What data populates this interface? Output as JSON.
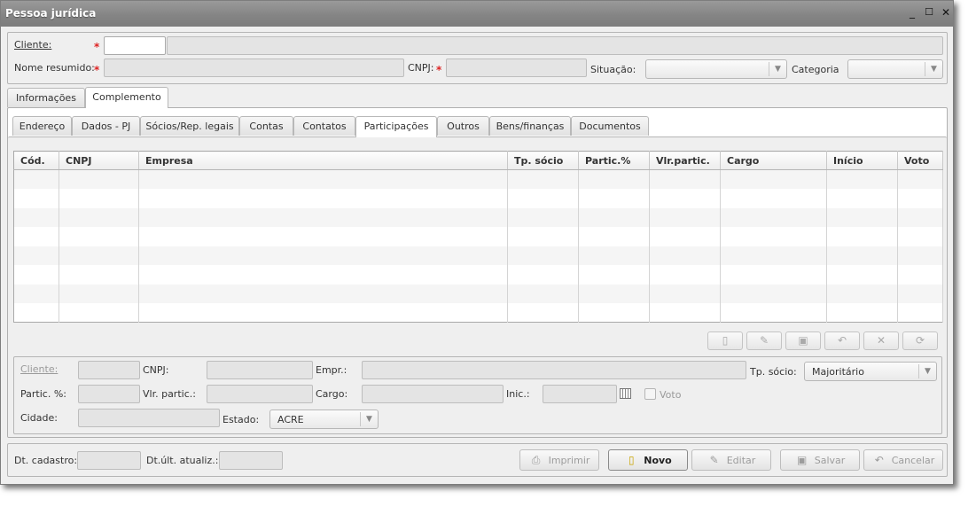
{
  "window": {
    "title": "Pessoa jurídica",
    "controls": {
      "minimize": "_",
      "maximize": "☐",
      "close": "✕"
    }
  },
  "header": {
    "cliente_label": "Cliente:",
    "nome_resumido_label": "Nome resumido:",
    "cnpj_label": "CNPJ:",
    "situacao_label": "Situação:",
    "categoria_label": "Categoria",
    "required_mark": "*",
    "situacao_value": "",
    "categoria_value": ""
  },
  "main_tabs": [
    {
      "label": "Informações",
      "active": false
    },
    {
      "label": "Complemento",
      "active": true
    }
  ],
  "sub_tabs": [
    {
      "label": "Endereço",
      "active": false
    },
    {
      "label": "Dados - PJ",
      "active": false
    },
    {
      "label": "Sócios/Rep. legais",
      "active": false
    },
    {
      "label": "Contas",
      "active": false
    },
    {
      "label": "Contatos",
      "active": false
    },
    {
      "label": "Participações",
      "active": true
    },
    {
      "label": "Outros",
      "active": false
    },
    {
      "label": "Bens/finanças",
      "active": false
    },
    {
      "label": "Documentos",
      "active": false
    }
  ],
  "grid": {
    "columns": [
      "Cód.",
      "CNPJ",
      "Empresa",
      "Tp. sócio",
      "Partic.%",
      "Vlr.partic.",
      "Cargo",
      "Início",
      "Voto"
    ],
    "row_count": 8
  },
  "grid_toolbar": {
    "icons": [
      "new-document-icon",
      "edit-pencil-icon",
      "save-disk-icon",
      "undo-arrow-icon",
      "delete-x-icon",
      "refresh-icon"
    ]
  },
  "detail": {
    "cliente_label": "Cliente:",
    "cnpj_label": "CNPJ:",
    "empr_label": "Empr.:",
    "tp_socio_label": "Tp. sócio:",
    "tp_socio_value": "Majoritário",
    "partic_label": "Partic. %:",
    "vlr_partic_label": "Vlr. partic.:",
    "cargo_label": "Cargo:",
    "inic_label": "Inic.:",
    "voto_label": "Voto",
    "cidade_label": "Cidade:",
    "estado_label": "Estado:",
    "estado_value": "ACRE"
  },
  "footer": {
    "dt_cadastro_label": "Dt. cadastro:",
    "dt_ult_label": "Dt.últ. atualiz.:",
    "buttons": {
      "imprimir": "Imprimir",
      "novo": "Novo",
      "editar": "Editar",
      "salvar": "Salvar",
      "cancelar": "Cancelar"
    }
  }
}
